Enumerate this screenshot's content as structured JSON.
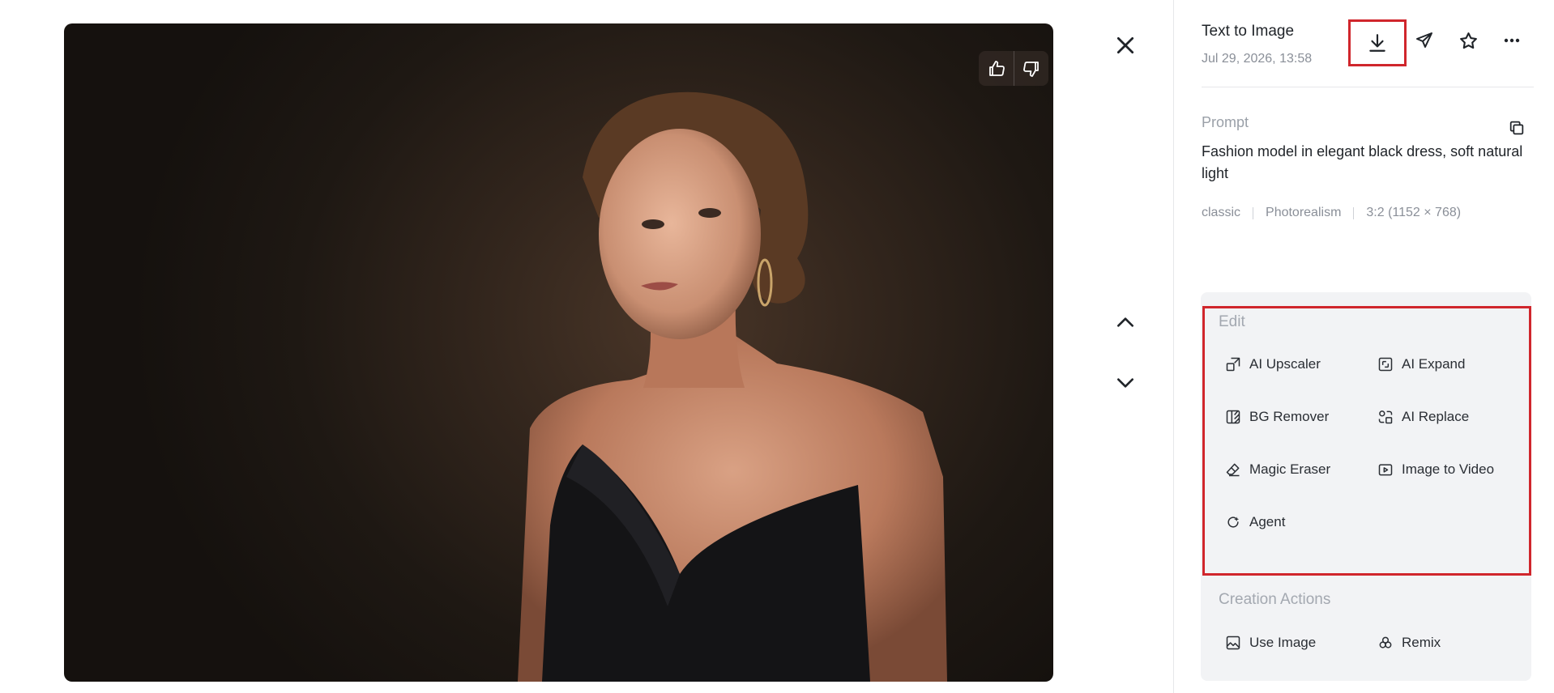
{
  "header": {
    "title": "Text to Image",
    "date": "Jul 29, 2026, 13:58"
  },
  "prompt": {
    "label": "Prompt",
    "text": "Fashion model in elegant black dress, soft natural light",
    "tags": [
      "classic",
      "Photorealism",
      "3:2 (1152 × 768)"
    ]
  },
  "edit": {
    "label": "Edit",
    "tools": [
      {
        "label": "AI Upscaler",
        "icon": "upscale-icon"
      },
      {
        "label": "AI Expand",
        "icon": "expand-icon"
      },
      {
        "label": "BG Remover",
        "icon": "bg-remove-icon"
      },
      {
        "label": "AI Replace",
        "icon": "replace-icon"
      },
      {
        "label": "Magic Eraser",
        "icon": "eraser-icon"
      },
      {
        "label": "Image to Video",
        "icon": "video-icon"
      },
      {
        "label": "Agent",
        "icon": "agent-icon"
      }
    ]
  },
  "creation": {
    "label": "Creation Actions",
    "tools": [
      {
        "label": "Use Image",
        "icon": "image-icon"
      },
      {
        "label": "Remix",
        "icon": "remix-icon"
      }
    ]
  },
  "colors": {
    "highlight": "#d0262c",
    "card_bg": "#f2f3f5",
    "muted_text": "#8a8f98"
  }
}
